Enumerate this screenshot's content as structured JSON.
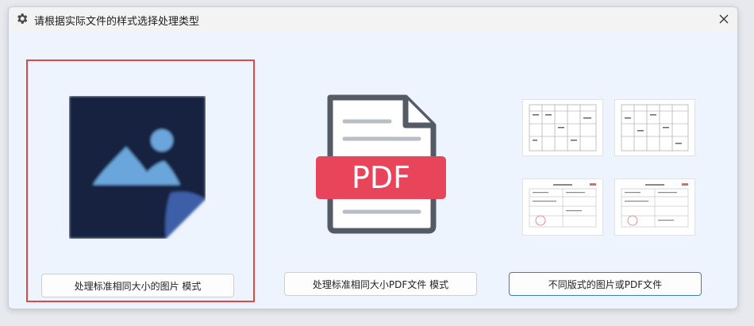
{
  "window": {
    "title": "请根据实际文件的样式选择处理类型",
    "icon": "gear-icon",
    "close_icon": "close-icon"
  },
  "options": [
    {
      "label": "处理标准相同大小的图片 模式",
      "icon": "image-file-icon",
      "selected": true
    },
    {
      "label": "处理标准相同大小PDF文件 模式",
      "icon": "pdf-file-icon",
      "selected": false
    },
    {
      "label": "不同版式的图片或PDF文件",
      "icon": "mixed-documents-icon",
      "selected": false
    }
  ],
  "pdf_badge": "PDF",
  "colors": {
    "selection_border": "#e04848",
    "pdf_red": "#e8445a",
    "image_dark": "#17233f",
    "image_fold": "#3c5ea8",
    "image_glyph": "#6aa6dc",
    "focus_border": "#3d7fb5"
  }
}
